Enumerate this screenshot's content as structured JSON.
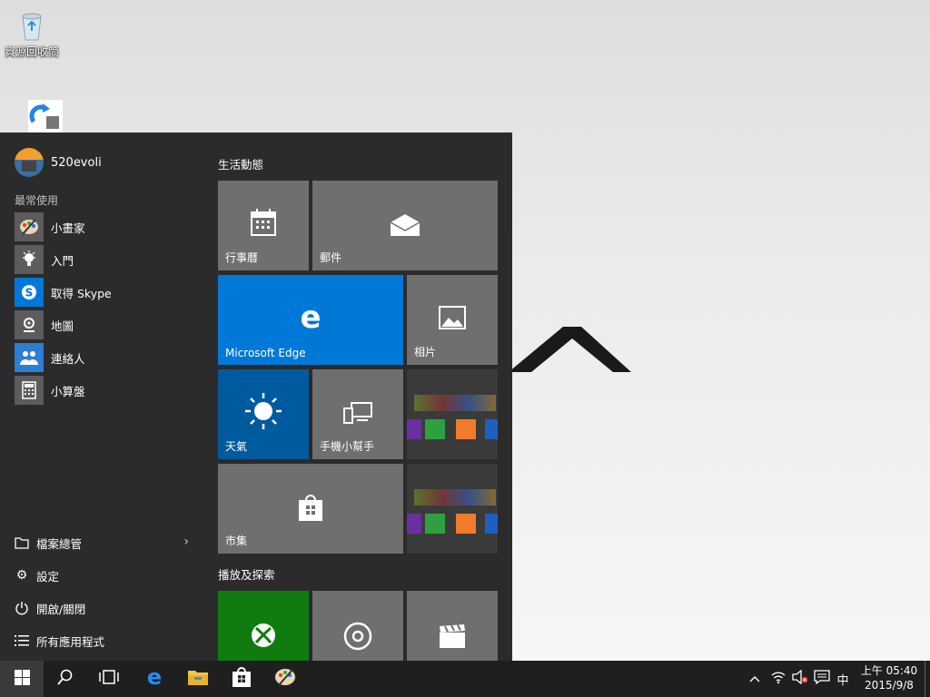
{
  "desktop": {
    "icons": [
      {
        "label": "資源回收筒"
      },
      {
        "label": ""
      }
    ]
  },
  "start_menu": {
    "user_name": "520evoli",
    "most_used_label": "最常使用",
    "apps": [
      {
        "label": "小畫家",
        "icon": "paint-icon"
      },
      {
        "label": "入門",
        "icon": "lightbulb-icon"
      },
      {
        "label": "取得 Skype",
        "icon": "skype-icon"
      },
      {
        "label": "地圖",
        "icon": "maps-icon"
      },
      {
        "label": "連絡人",
        "icon": "people-icon"
      },
      {
        "label": "小算盤",
        "icon": "calculator-icon"
      }
    ],
    "bottom": {
      "file_explorer": "檔案總管",
      "settings": "設定",
      "power": "開啟/關閉",
      "all_apps": "所有應用程式"
    },
    "groups": {
      "life": "生活動態",
      "play": "播放及探索"
    },
    "tiles": {
      "calendar": "行事曆",
      "mail": "郵件",
      "edge": "Microsoft Edge",
      "photos": "相片",
      "weather": "天氣",
      "phone": "手機小幫手",
      "store": "市集"
    }
  },
  "taskbar": {
    "ime": "中",
    "time": "上午 05:40",
    "date": "2015/9/8"
  },
  "colors": {
    "start_bg": "#2b2b2b",
    "tile_grey": "#6f6f6f",
    "tile_blue": "#0078d7",
    "weather_blue": "#005a9e",
    "xbox_green": "#107c10",
    "taskbar": "#1f1f1f"
  }
}
